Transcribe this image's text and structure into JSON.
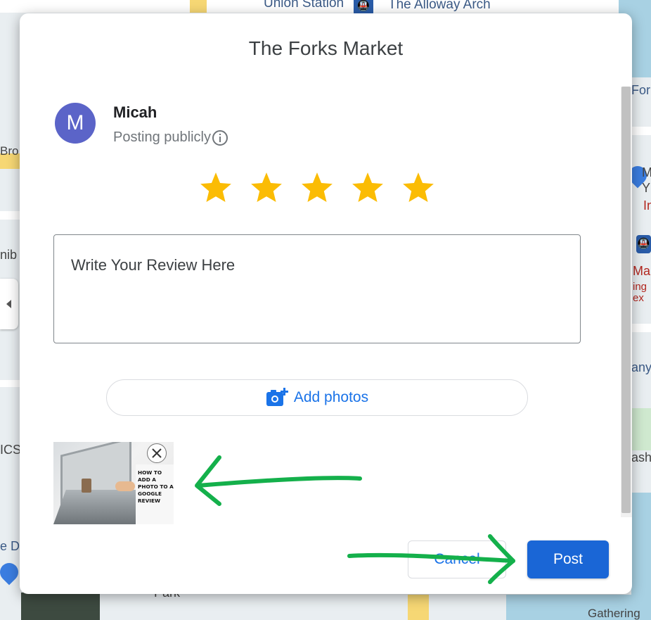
{
  "map": {
    "labels": {
      "union_station": "Union Station",
      "alloway_arch": "The Alloway Arch",
      "street_left": "Bro",
      "forks_partial": "Fork",
      "nib_partial": "nib",
      "m_partial": "M",
      "y_partial": "Y",
      "in_partial": "In",
      "mar_partial": "Mar",
      "ing_partial": "ing",
      "ex_partial": "ex",
      "any_partial": "any",
      "ics_partial": "ICS",
      "ash_partial": "ash",
      "edo_partial": "e Do",
      "park_partial": "Park",
      "gathering_partial": "Gathering"
    },
    "transit_glyph": "🚇"
  },
  "dialog": {
    "title": "The Forks Market",
    "user": {
      "initial": "M",
      "name": "Micah",
      "posting_status": "Posting publicly"
    },
    "rating": {
      "value": 5,
      "max": 5,
      "star_color": "#fbbc04"
    },
    "review": {
      "placeholder": "Write Your Review Here"
    },
    "add_photos_label": "Add photos",
    "photo_thumbnail": {
      "caption": "HOW TO ADD A PHOTO TO A GOOGLE REVIEW"
    },
    "buttons": {
      "cancel": "Cancel",
      "post": "Post"
    }
  },
  "colors": {
    "accent": "#1a73e8",
    "post_bg": "#1a66d6",
    "avatar_bg": "#5b64c8",
    "annotation_arrow": "#14b04b"
  }
}
